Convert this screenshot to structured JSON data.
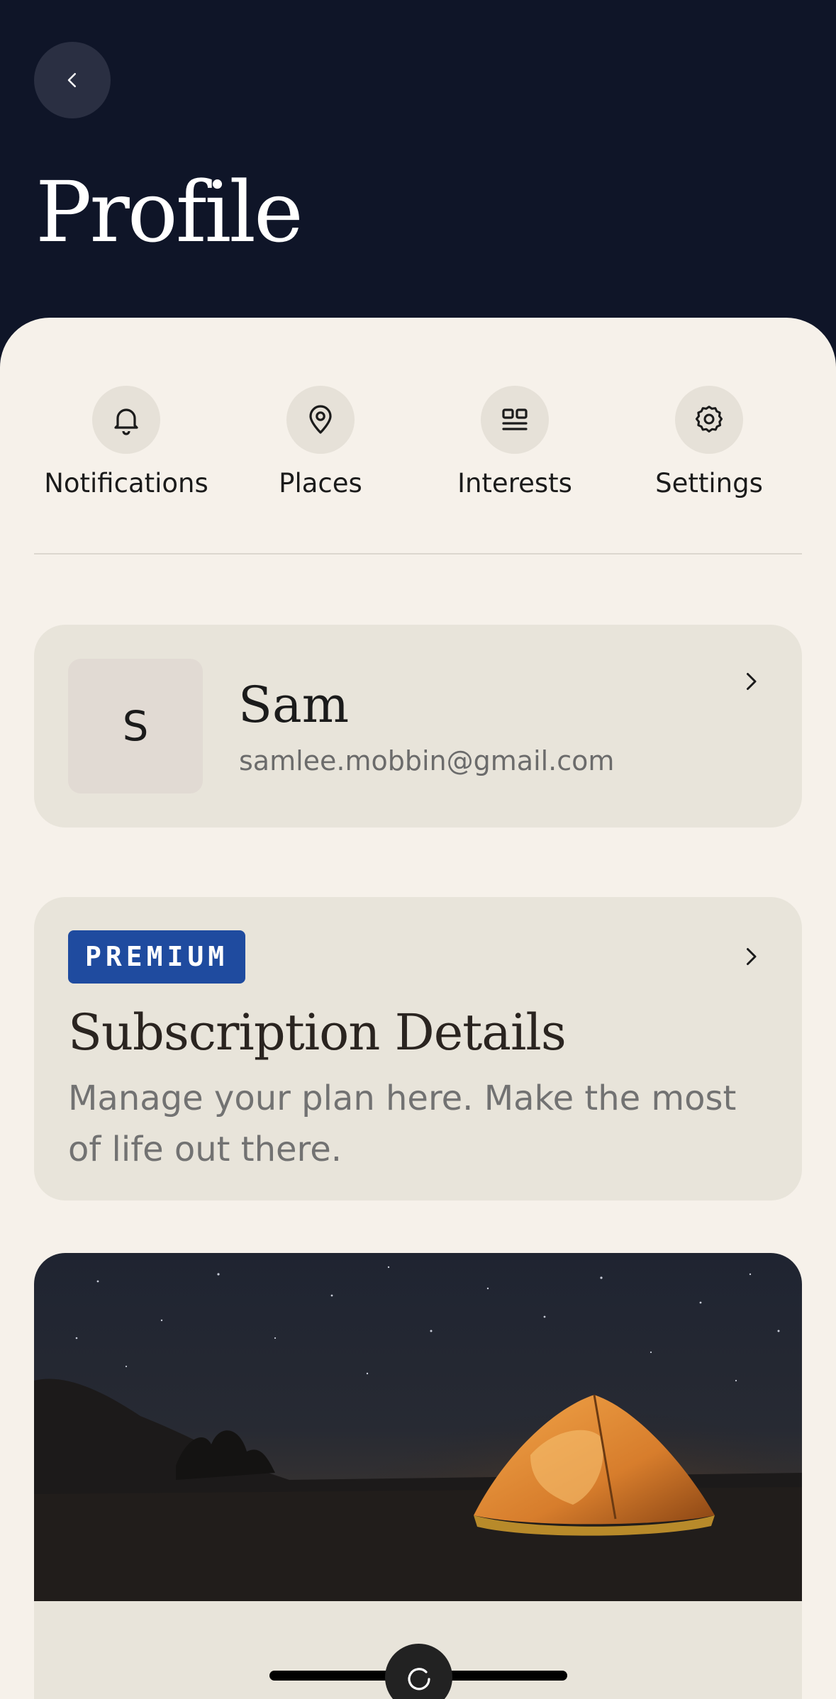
{
  "header": {
    "title": "Profile",
    "back_icon": "chevron-left-icon"
  },
  "quick_nav": [
    {
      "label": "Notifications",
      "icon": "bell-icon"
    },
    {
      "label": "Places",
      "icon": "map-pin-icon"
    },
    {
      "label": "Interests",
      "icon": "grid-icon"
    },
    {
      "label": "Settings",
      "icon": "gear-icon"
    }
  ],
  "profile": {
    "initial": "S",
    "name": "Sam",
    "email": "samlee.mobbin@gmail.com"
  },
  "subscription": {
    "badge": "PREMIUM",
    "title": "Subscription Details",
    "description": "Manage your plan here. Make the most of life out there."
  },
  "colors": {
    "header_bg": "#0f1528",
    "sheet_bg": "#f6f1ea",
    "card_bg": "#e8e4da",
    "badge_bg": "#1f4b9f"
  }
}
